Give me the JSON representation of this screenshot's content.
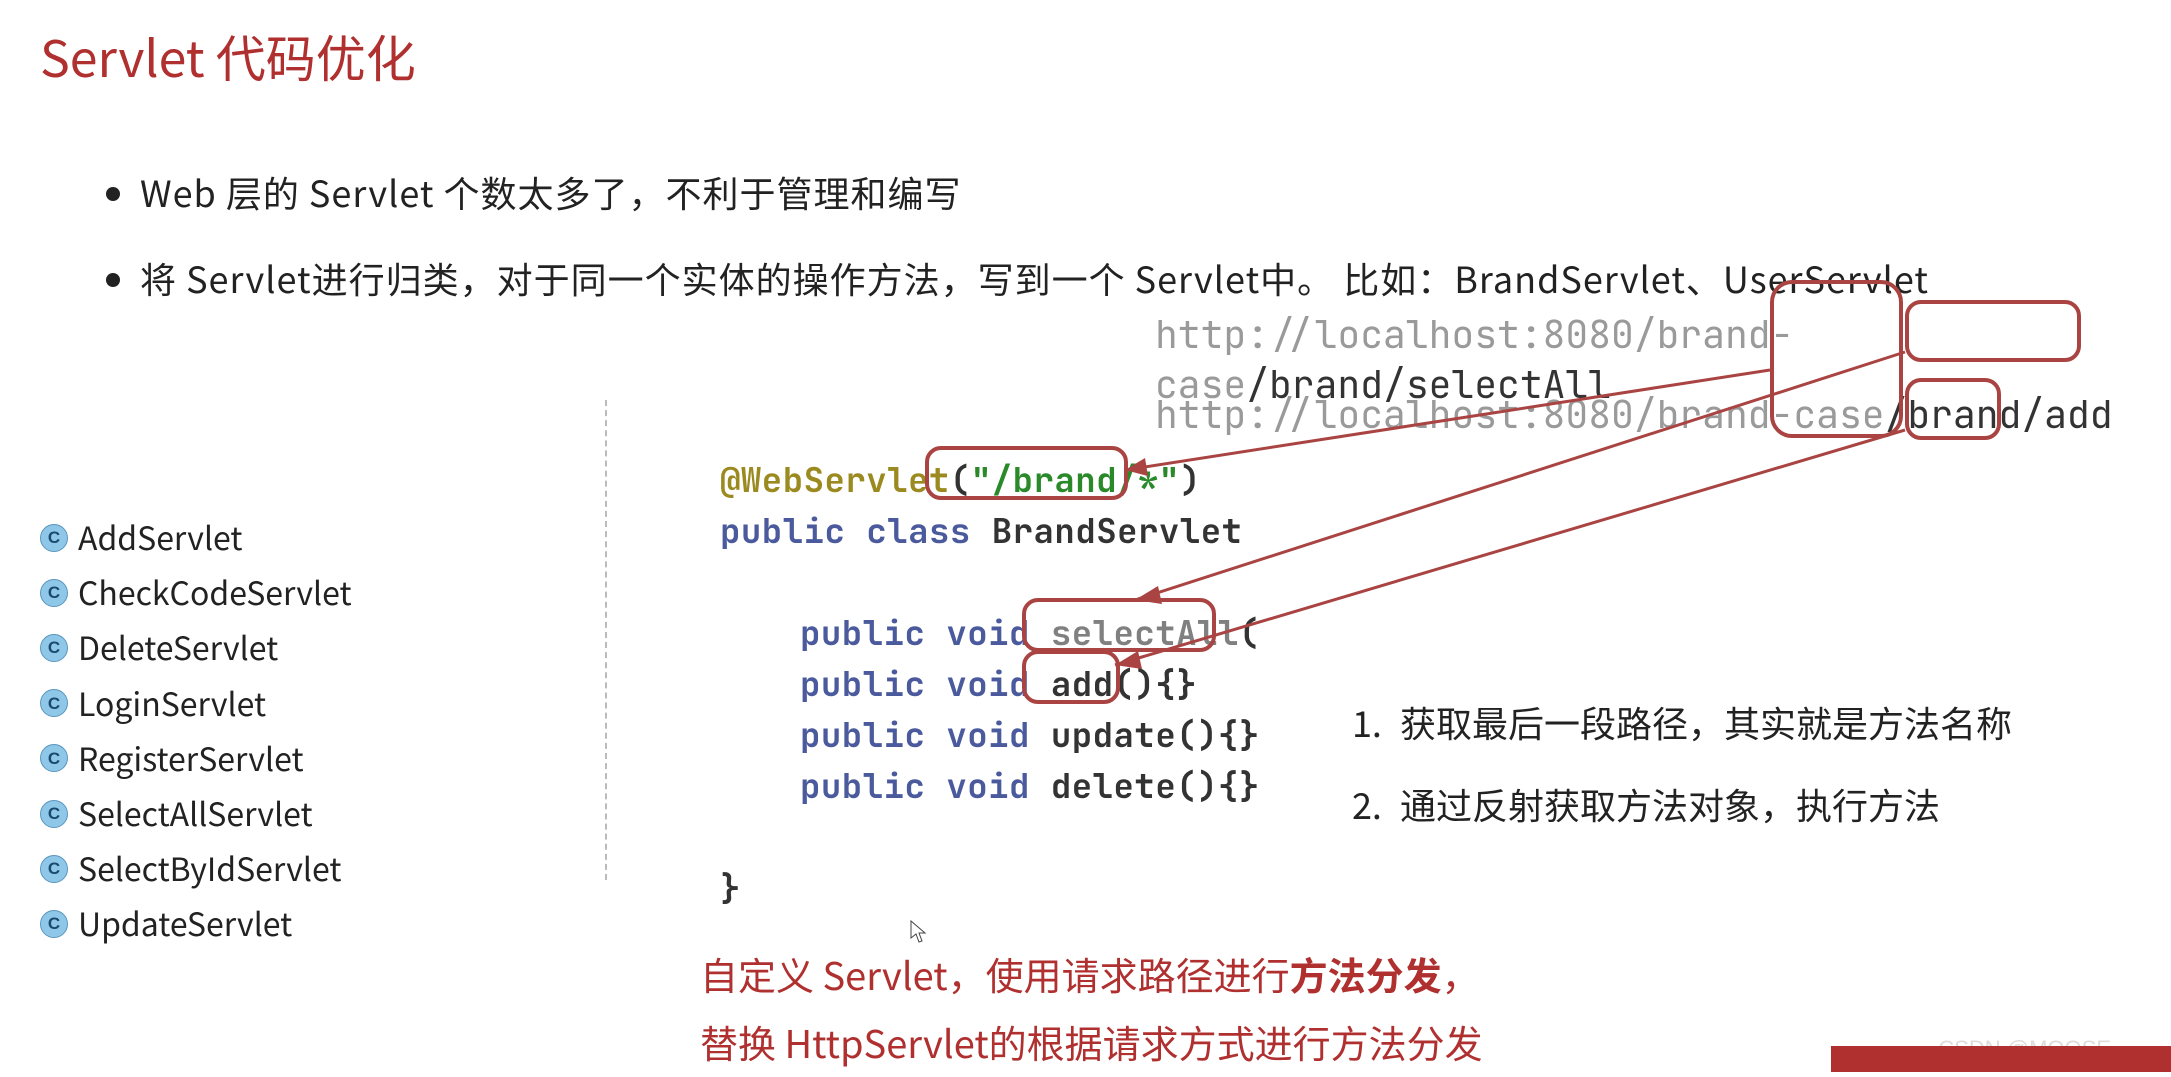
{
  "title": "Servlet 代码优化",
  "bullets": [
    "Web 层的 Servlet 个数太多了，不利于管理和编写",
    "将 Servlet进行归类，对于同一个实体的操作方法，写到一个 Servlet中。 比如：BrandServlet、UserServlet"
  ],
  "class_list": [
    "AddServlet",
    "CheckCodeServlet",
    "DeleteServlet",
    "LoginServlet",
    "RegisterServlet",
    "SelectAllServlet",
    "SelectByIdServlet",
    "UpdateServlet"
  ],
  "class_icon_letter": "C",
  "urls": {
    "line1": {
      "prefix": "http://localhost:8080/brand-case",
      "seg1": "/brand",
      "seg2": "/selectAll"
    },
    "line2": {
      "prefix": "http://localhost:8080/brand-case",
      "seg1": "/brand",
      "seg2": "/add"
    }
  },
  "code": {
    "annotation": "@WebServlet",
    "ann_open": "(",
    "ann_str": "\"/brand/*\"",
    "ann_close": ")",
    "public": "public",
    "class_kw": "class",
    "void": "void",
    "class_name": "BrandServlet",
    "m_selectAll": "selectAll",
    "tail_selectAll": "(",
    "m_add": "add",
    "tail_add": "(){}",
    "m_update": "update",
    "tail_update": "(){}",
    "m_delete": "delete",
    "tail_delete": "(){}",
    "close_brace": "}"
  },
  "steps": [
    "获取最后一段路径，其实就是方法名称",
    "通过反射获取方法对象，执行方法"
  ],
  "bottom": {
    "line1_a": "自定义 Servlet，使用请求路径进行",
    "line1_b": "方法分发",
    "line1_c": "，",
    "line2": "替换 HttpServlet的根据请求方式进行方法分发"
  },
  "watermark": "CSDN @MOOSE"
}
